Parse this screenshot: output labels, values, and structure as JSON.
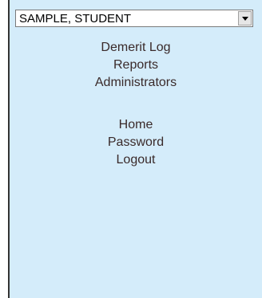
{
  "student_select": {
    "value": "SAMPLE, STUDENT"
  },
  "nav_primary": [
    {
      "label": "Demerit Log"
    },
    {
      "label": "Reports"
    },
    {
      "label": "Administrators"
    }
  ],
  "nav_secondary": [
    {
      "label": "Home"
    },
    {
      "label": "Password"
    },
    {
      "label": "Logout"
    }
  ],
  "colors": {
    "panel_background": "#d4ecfa",
    "link_text": "#3a2a2a"
  },
  "icons": {
    "dropdown": "chevron-down-icon"
  }
}
